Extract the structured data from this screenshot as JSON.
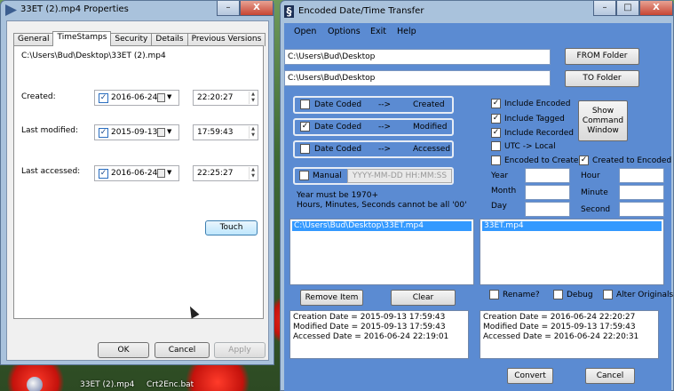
{
  "props_window": {
    "title": "33ET (2).mp4 Properties",
    "caption_buttons": {
      "minimize": "–",
      "close": "X"
    },
    "tabs": [
      "General",
      "TimeStamps",
      "Security",
      "Details",
      "Previous Versions"
    ],
    "file_path": "C:\\Users\\Bud\\Desktop\\33ET (2).mp4",
    "rows": [
      {
        "label": "Created:",
        "date": "2016-06-24",
        "time": "22:20:27"
      },
      {
        "label": "Last modified:",
        "date": "2015-09-13",
        "time": "17:59:43"
      },
      {
        "label": "Last accessed:",
        "date": "2016-06-24",
        "time": "22:25:27"
      }
    ],
    "touch_label": "Touch",
    "ok_label": "OK",
    "cancel_label": "Cancel",
    "apply_label": "Apply"
  },
  "transfer_window": {
    "title": "Encoded Date/Time Transfer",
    "caption_buttons": {
      "minimize": "–",
      "maximize": "□",
      "close": "X"
    },
    "menu": [
      "Open",
      "Options",
      "Exit",
      "Help"
    ],
    "from_path": "C:\\Users\\Bud\\Desktop",
    "to_path": "C:\\Users\\Bud\\Desktop",
    "from_button": "FROM Folder",
    "to_button": "TO Folder",
    "mappings": [
      {
        "source": "Date Coded",
        "arrow": "-->",
        "target": "Created",
        "checked": false
      },
      {
        "source": "Date Coded",
        "arrow": "-->",
        "target": "Modified",
        "checked": true
      },
      {
        "source": "Date Coded",
        "arrow": "-->",
        "target": "Accessed",
        "checked": false
      }
    ],
    "manual_label": "Manual",
    "manual_placeholder": "YYYY-MM-DD HH:MM:SS",
    "note_line1": "Year must be 1970+",
    "note_line2": "Hours, Minutes, Seconds cannot be all '00'",
    "options": [
      {
        "label": "Include Encoded",
        "checked": true
      },
      {
        "label": "Include Tagged",
        "checked": true
      },
      {
        "label": "Include Recorded",
        "checked": true
      },
      {
        "label": "UTC -> Local",
        "checked": false
      },
      {
        "label": "Encoded to Created",
        "checked": false
      },
      {
        "label": "Created to Encoded",
        "checked": true
      }
    ],
    "show_command_lines": [
      "Show",
      "Command",
      "Window"
    ],
    "fields": {
      "year": "Year",
      "month": "Month",
      "day": "Day",
      "hour": "Hour",
      "minute": "Minute",
      "second": "Second"
    },
    "list_left": [
      "C:\\Users\\Bud\\Desktop\\33ET.mp4"
    ],
    "list_right": [
      "33ET.mp4"
    ],
    "remove_item": "Remove Item",
    "clear": "Clear",
    "rename": "Rename?",
    "debug": "Debug",
    "alter": "Alter Originals",
    "left_memo": [
      "Creation Date = 2015-09-13 17:59:43",
      "Modified Date = 2015-09-13 17:59:43",
      "Accessed Date = 2016-06-24 22:19:01"
    ],
    "right_memo": [
      "Creation Date = 2016-06-24 22:20:27",
      "Modified Date = 2015-09-13 17:59:43",
      "Accessed Date = 2016-06-24 22:20:31"
    ],
    "convert": "Convert",
    "cancel": "Cancel"
  },
  "desktop": {
    "icons": [
      "33ET (2).mp4",
      "Crt2Enc.bat"
    ]
  }
}
